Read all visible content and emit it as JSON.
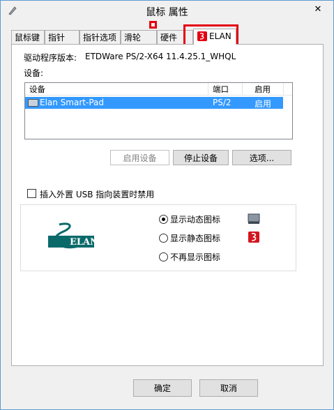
{
  "window": {
    "title": "鼠标 属性",
    "close_glyph": "✕"
  },
  "tabs": [
    {
      "label": "鼠标键"
    },
    {
      "label": "指针"
    },
    {
      "label": "指针选项"
    },
    {
      "label": "滑轮"
    },
    {
      "label": "硬件"
    },
    {
      "label": "ELAN"
    }
  ],
  "elan": {
    "driver_version_label": "驱动程序版本:",
    "driver_version_value": "ETDWare PS/2-X64 11.4.25.1_WHQL",
    "devices_label": "设备:",
    "list_headers": [
      "设备",
      "端口",
      "启用"
    ],
    "list_rows": [
      {
        "device": "Elan Smart-Pad",
        "port": "PS/2",
        "enabled": "启用"
      }
    ],
    "buttons": {
      "enable": "启用设备",
      "disable": "停止设备",
      "options": "选项..."
    },
    "usb_checkbox_label": "插入外置 USB 指向装置时禁用",
    "usb_checkbox_checked": false,
    "logo_text": "ELAN",
    "tray_options": [
      {
        "label": "显示动态图标",
        "selected": true
      },
      {
        "label": "显示静态图标",
        "selected": false
      },
      {
        "label": "不再显示图标",
        "selected": false
      }
    ]
  },
  "footer": {
    "ok": "确定",
    "cancel": "取消"
  },
  "colors": {
    "selection": "#3399ff",
    "highlight": "#e30012",
    "logo": "#0a6a6a"
  }
}
